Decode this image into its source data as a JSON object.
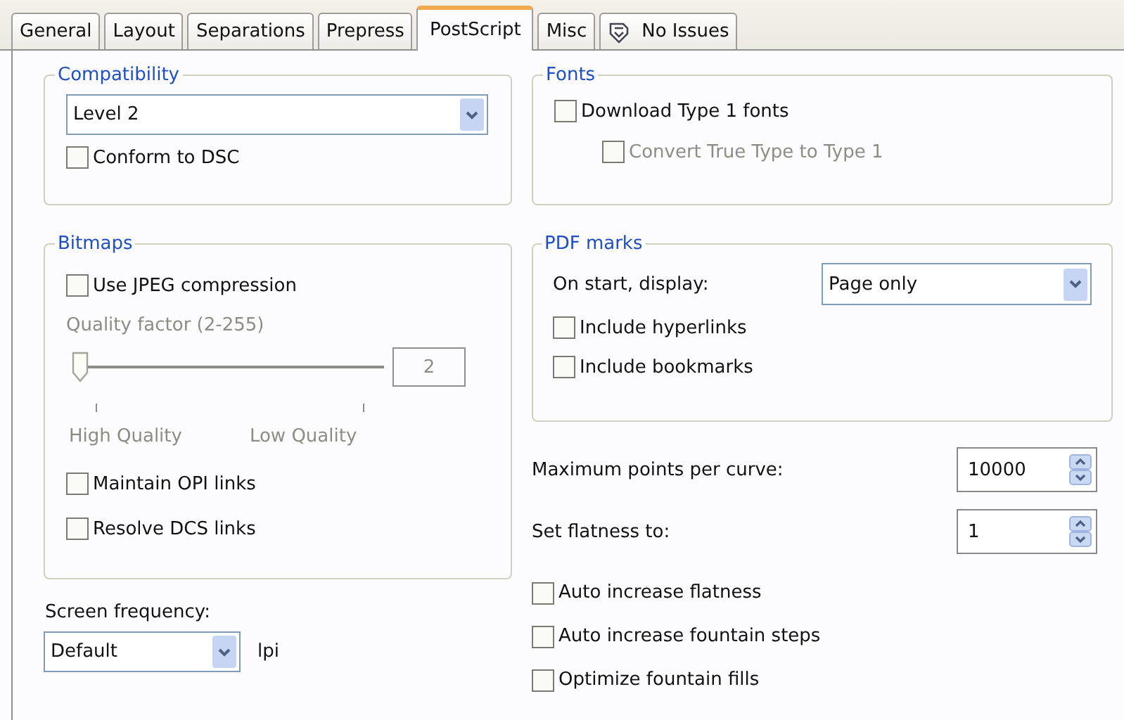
{
  "tabs": [
    {
      "label": "General",
      "selected": false,
      "kind": "text"
    },
    {
      "label": "Layout",
      "selected": false,
      "kind": "text"
    },
    {
      "label": "Separations",
      "selected": false,
      "kind": "text"
    },
    {
      "label": "Prepress",
      "selected": false,
      "kind": "text"
    },
    {
      "label": "PostScript",
      "selected": true,
      "kind": "text"
    },
    {
      "label": "Misc",
      "selected": false,
      "kind": "text"
    },
    {
      "label": "No Issues",
      "selected": false,
      "kind": "status"
    }
  ],
  "compatibility": {
    "title": "Compatibility",
    "dropdown": {
      "value": "Level 2"
    },
    "checkboxes": [
      {
        "label": "Conform to DSC",
        "checked": false,
        "disabled": false
      }
    ]
  },
  "fonts": {
    "title": "Fonts",
    "checkboxes": [
      {
        "label": "Download Type 1 fonts",
        "checked": false,
        "disabled": false,
        "children": [
          {
            "label": "Convert True Type to Type 1",
            "checked": false,
            "disabled": true
          }
        ]
      }
    ]
  },
  "bitmaps": {
    "title": "Bitmaps",
    "jpeg": {
      "label": "Use JPEG compression",
      "checked": false,
      "disabled": false
    },
    "quality": {
      "label": "Quality factor (2-255)",
      "disabled": true,
      "level": 0,
      "value": "2",
      "min_label": "High Quality",
      "max_label": "Low Quality"
    },
    "checkboxes": [
      {
        "label": "Maintain OPI links",
        "checked": false,
        "disabled": false
      },
      {
        "label": "Resolve DCS links",
        "checked": false,
        "disabled": false
      }
    ]
  },
  "pdf_marks": {
    "title": "PDF marks",
    "display_label": "On start, display:",
    "display_value": "Page only",
    "checkboxes": [
      {
        "label": "Include hyperlinks",
        "checked": false,
        "disabled": false
      },
      {
        "label": "Include bookmarks",
        "checked": false,
        "disabled": false
      }
    ]
  },
  "spinners": [
    {
      "label": "Maximum points per curve:",
      "value": "10000"
    },
    {
      "label": "Set flatness to:",
      "value": "1"
    }
  ],
  "options": [
    {
      "label": "Auto increase flatness",
      "checked": false,
      "disabled": false
    },
    {
      "label": "Auto increase fountain steps",
      "checked": false,
      "disabled": false
    },
    {
      "label": "Optimize fountain fills",
      "checked": false,
      "disabled": false
    }
  ],
  "screen_frequency": {
    "label": "Screen frequency:",
    "value": "Default",
    "unit": "lpi"
  }
}
